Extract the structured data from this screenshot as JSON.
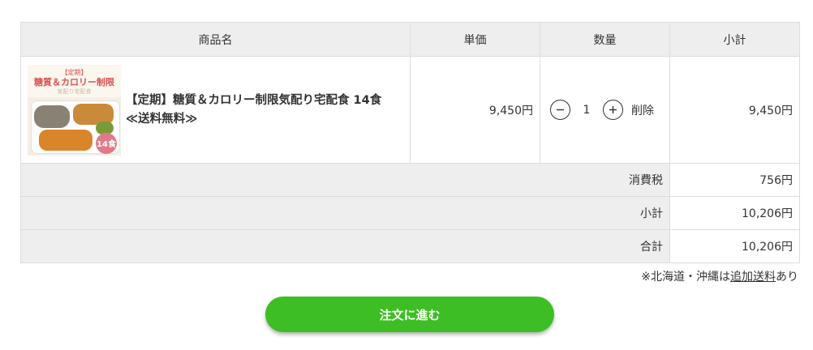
{
  "table": {
    "headers": {
      "name": "商品名",
      "price": "単価",
      "quantity": "数量",
      "subtotal": "小計"
    },
    "items": [
      {
        "name_line1": "【定期】糖質＆カロリー制限気配り宅配食 14食",
        "name_line2": "≪送料無料≫",
        "unit_price": "9,450円",
        "quantity": "1",
        "delete_label": "削除",
        "subtotal": "9,450円",
        "thumbnail": {
          "tag": "【定期】",
          "title": "糖質＆カロリー制限",
          "subtitle": "気配り宅配食",
          "badge": "14食"
        }
      }
    ],
    "summary": [
      {
        "label": "消費税",
        "value": "756円"
      },
      {
        "label": "小計",
        "value": "10,206円"
      },
      {
        "label": "合計",
        "value": "10,206円"
      }
    ]
  },
  "note": {
    "prefix": "※北海道・沖縄は",
    "link": "追加送料",
    "suffix": "あり"
  },
  "checkout": {
    "label": "注文に進む",
    "color": "#3dbe24"
  },
  "icons": {
    "decrease": "minus-circle-icon",
    "increase": "plus-circle-icon"
  }
}
